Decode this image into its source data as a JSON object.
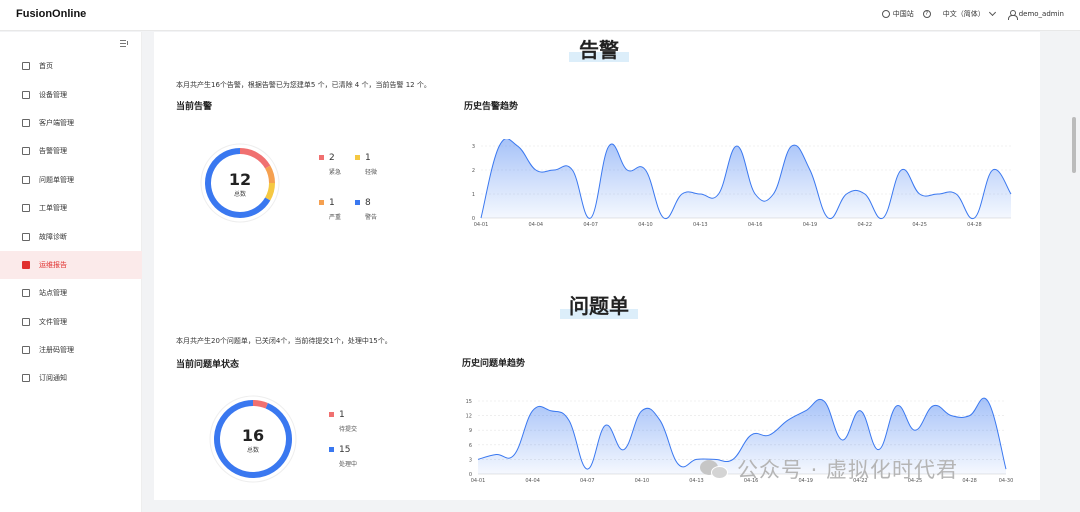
{
  "header": {
    "logo": "FusionOnline",
    "site": "中国站",
    "language": "中文（简体）",
    "user": "demo_admin"
  },
  "sidebar": {
    "items": [
      {
        "label": "首页",
        "icon": "home-icon",
        "active": false
      },
      {
        "label": "设备管理",
        "icon": "device-icon",
        "active": false
      },
      {
        "label": "客户端管理",
        "icon": "monitor-icon",
        "active": false
      },
      {
        "label": "告警管理",
        "icon": "bell-icon",
        "active": false
      },
      {
        "label": "问题单管理",
        "icon": "ticket-icon",
        "active": false
      },
      {
        "label": "工单管理",
        "icon": "bell-icon",
        "active": false
      },
      {
        "label": "故障诊断",
        "icon": "diagnosis-icon",
        "active": false
      },
      {
        "label": "运维报告",
        "icon": "report-icon",
        "active": true
      },
      {
        "label": "站点管理",
        "icon": "bar-chart-icon",
        "active": false
      },
      {
        "label": "文件管理",
        "icon": "file-icon",
        "active": false
      },
      {
        "label": "注册码管理",
        "icon": "grid-icon",
        "active": false
      },
      {
        "label": "订阅通知",
        "icon": "subscribe-icon",
        "active": false
      }
    ]
  },
  "alarms": {
    "section_title": "告警",
    "summary": "本月共产生16个告警，根据告警已为您建单5 个，已清除 4 个，当前告警 12 个。",
    "current_title": "当前告警",
    "total": "12",
    "total_label": "总数",
    "legend": [
      {
        "count": "2",
        "label": "紧急",
        "color": "#f07070"
      },
      {
        "count": "1",
        "label": "轻微",
        "color": "#f5c842"
      },
      {
        "count": "1",
        "label": "严重",
        "color": "#f5a050"
      },
      {
        "count": "8",
        "label": "警告",
        "color": "#3a78f0"
      }
    ],
    "trend_title": "历史告警趋势"
  },
  "tickets": {
    "section_title": "问题单",
    "summary": "本月共产生20个问题单，已关闭4个，当前待提交1个，处理中15个。",
    "current_title": "当前问题单状态",
    "total": "16",
    "total_label": "总数",
    "legend": [
      {
        "count": "1",
        "label": "待提交",
        "color": "#f07070"
      },
      {
        "count": "15",
        "label": "处理中",
        "color": "#3a78f0"
      }
    ],
    "trend_title": "历史问题单趋势"
  },
  "watermark": "公众号 · 虚拟化时代君",
  "chart_data": [
    {
      "type": "area",
      "x": [
        "04-01",
        "04-02",
        "04-03",
        "04-04",
        "04-05",
        "04-06",
        "04-07",
        "04-08",
        "04-09",
        "04-10",
        "04-11",
        "04-12",
        "04-13",
        "04-14",
        "04-15",
        "04-16",
        "04-17",
        "04-18",
        "04-19",
        "04-20",
        "04-21",
        "04-22",
        "04-23",
        "04-24",
        "04-25",
        "04-26",
        "04-27",
        "04-28",
        "04-29",
        "04-30"
      ],
      "xticks": [
        "04-01",
        "04-04",
        "04-07",
        "04-10",
        "04-13",
        "04-16",
        "04-19",
        "04-22",
        "04-25",
        "04-28"
      ],
      "values": [
        0,
        3,
        3,
        2,
        2,
        2,
        0,
        3,
        2,
        2,
        0,
        1,
        1,
        1,
        3,
        1,
        1,
        3,
        2,
        0,
        1,
        1,
        0,
        2,
        1,
        1,
        1,
        0,
        2,
        1
      ],
      "yticks": [
        0,
        1,
        2,
        3
      ],
      "ylim": [
        0,
        3
      ],
      "color": "#3a78f0"
    },
    {
      "type": "area",
      "x": [
        "04-01",
        "04-02",
        "04-03",
        "04-04",
        "04-05",
        "04-06",
        "04-07",
        "04-08",
        "04-09",
        "04-10",
        "04-11",
        "04-12",
        "04-13",
        "04-14",
        "04-15",
        "04-16",
        "04-17",
        "04-18",
        "04-19",
        "04-20",
        "04-21",
        "04-22",
        "04-23",
        "04-24",
        "04-25",
        "04-26",
        "04-27",
        "04-28",
        "04-29",
        "04-30"
      ],
      "xticks": [
        "04-01",
        "04-04",
        "04-07",
        "04-10",
        "04-13",
        "04-16",
        "04-19",
        "04-22",
        "04-25",
        "04-28",
        "04-30"
      ],
      "values": [
        3,
        4,
        4,
        13,
        13,
        11,
        1,
        10,
        5,
        13,
        11,
        2,
        3,
        3,
        3,
        8,
        8,
        11,
        13,
        15,
        7,
        13,
        5,
        14,
        9,
        14,
        12,
        12,
        15,
        1
      ],
      "yticks": [
        0,
        3,
        6,
        9,
        12,
        15
      ],
      "ylim": [
        0,
        15
      ],
      "color": "#3a78f0"
    }
  ]
}
